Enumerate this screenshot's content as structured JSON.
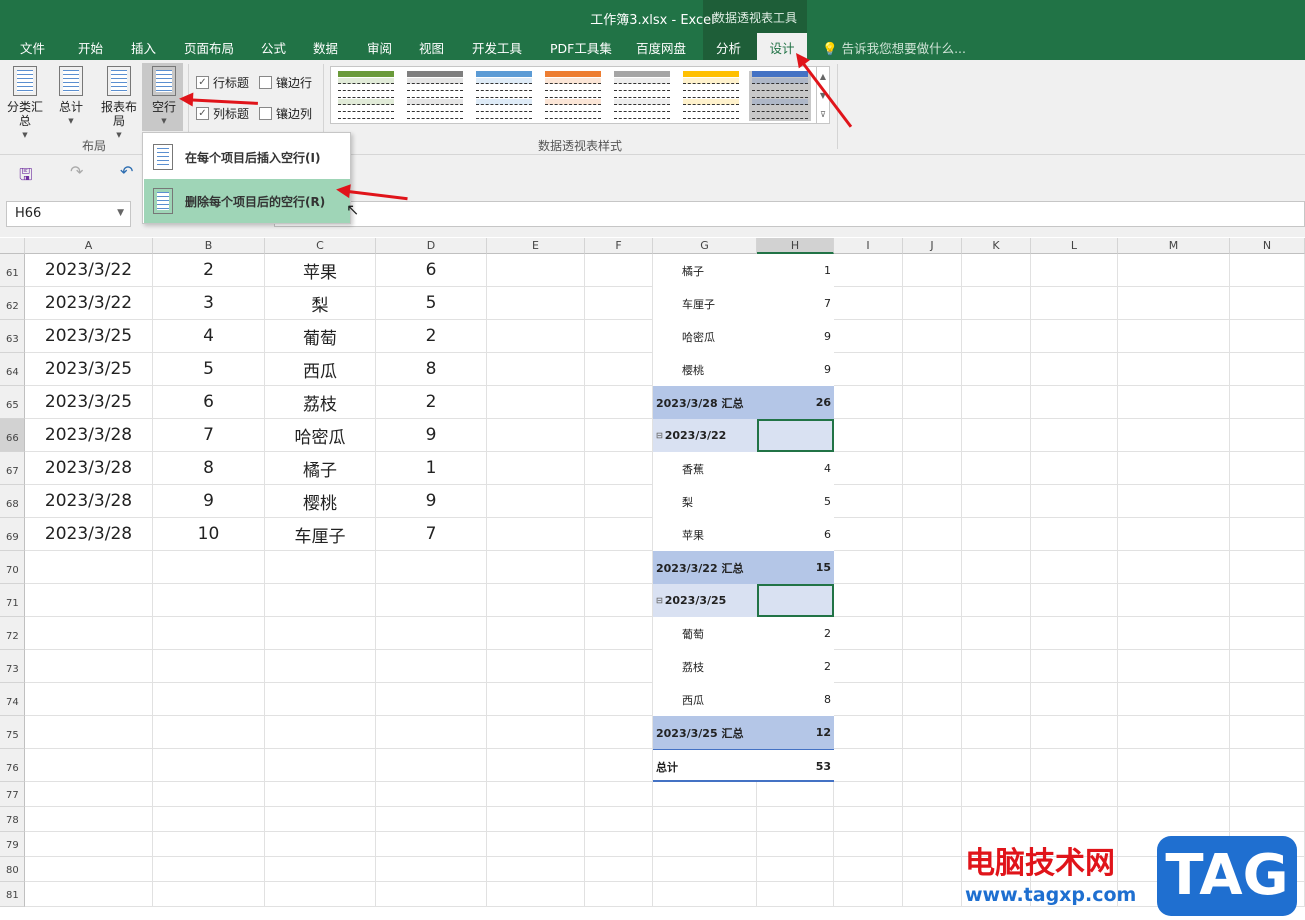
{
  "window": {
    "title": "工作簿3.xlsx - Excel",
    "context_tab_group": "数据透视表工具"
  },
  "tabs": [
    "文件",
    "开始",
    "插入",
    "页面布局",
    "公式",
    "数据",
    "审阅",
    "视图",
    "开发工具",
    "PDF工具集",
    "百度网盘",
    "分析",
    "设计"
  ],
  "tell_me": "告诉我您想要做什么...",
  "ribbon": {
    "layout_buttons": [
      {
        "label": "分类汇",
        "label2": "总"
      },
      {
        "label": "总计",
        "label2": ""
      },
      {
        "label": "报表布",
        "label2": "局"
      },
      {
        "label": "空行",
        "label2": ""
      }
    ],
    "layout_group": "布局",
    "checkboxes": [
      {
        "label": "行标题",
        "checked": true
      },
      {
        "label": "镶边行",
        "checked": false
      },
      {
        "label": "列标题",
        "checked": true
      },
      {
        "label": "镶边列",
        "checked": false
      }
    ],
    "styles_group": "数据透视表样式",
    "style_colors": [
      "#6a9a3a",
      "#7f7f7f",
      "#5b9bd5",
      "#ed7d31",
      "#a5a5a5",
      "#ffc000",
      "#4472c4"
    ]
  },
  "menu": {
    "items": [
      "在每个项目后插入空行(I)",
      "删除每个项目后的空行(R)"
    ]
  },
  "name_box": "H66",
  "columns": [
    "A",
    "B",
    "C",
    "D",
    "E",
    "F",
    "G",
    "H",
    "I",
    "J",
    "K",
    "L",
    "M",
    "N"
  ],
  "rows": [
    "61",
    "62",
    "63",
    "64",
    "65",
    "66",
    "67",
    "68",
    "69",
    "70",
    "71",
    "72",
    "73",
    "74",
    "75",
    "76",
    "77",
    "78",
    "79",
    "80",
    "81"
  ],
  "table": [
    [
      "2023/3/22",
      "2",
      "苹果",
      "6"
    ],
    [
      "2023/3/22",
      "3",
      "梨",
      "5"
    ],
    [
      "2023/3/25",
      "4",
      "葡萄",
      "2"
    ],
    [
      "2023/3/25",
      "5",
      "西瓜",
      "8"
    ],
    [
      "2023/3/25",
      "6",
      "荔枝",
      "2"
    ],
    [
      "2023/3/28",
      "7",
      "哈密瓜",
      "9"
    ],
    [
      "2023/3/28",
      "8",
      "橘子",
      "1"
    ],
    [
      "2023/3/28",
      "9",
      "樱桃",
      "9"
    ],
    [
      "2023/3/28",
      "10",
      "车厘子",
      "7"
    ]
  ],
  "pivot": [
    {
      "type": "item",
      "label": "橘子",
      "value": "1"
    },
    {
      "type": "item",
      "label": "车厘子",
      "value": "7"
    },
    {
      "type": "item",
      "label": "哈密瓜",
      "value": "9"
    },
    {
      "type": "item",
      "label": "樱桃",
      "value": "9"
    },
    {
      "type": "subtotal",
      "label": "2023/3/28 汇总",
      "value": "26"
    },
    {
      "type": "group",
      "label": "2023/3/22",
      "value": ""
    },
    {
      "type": "item",
      "label": "香蕉",
      "value": "4"
    },
    {
      "type": "item",
      "label": "梨",
      "value": "5"
    },
    {
      "type": "item",
      "label": "苹果",
      "value": "6"
    },
    {
      "type": "subtotal",
      "label": "2023/3/22 汇总",
      "value": "15"
    },
    {
      "type": "group",
      "label": "2023/3/25",
      "value": ""
    },
    {
      "type": "item",
      "label": "葡萄",
      "value": "2"
    },
    {
      "type": "item",
      "label": "荔枝",
      "value": "2"
    },
    {
      "type": "item",
      "label": "西瓜",
      "value": "8"
    },
    {
      "type": "subtotal",
      "label": "2023/3/25 汇总",
      "value": "12"
    },
    {
      "type": "total",
      "label": "总计",
      "value": "53"
    }
  ],
  "watermark": {
    "cn": "电脑技术网",
    "url": "www.tagxp.com",
    "logo": "TAG"
  }
}
